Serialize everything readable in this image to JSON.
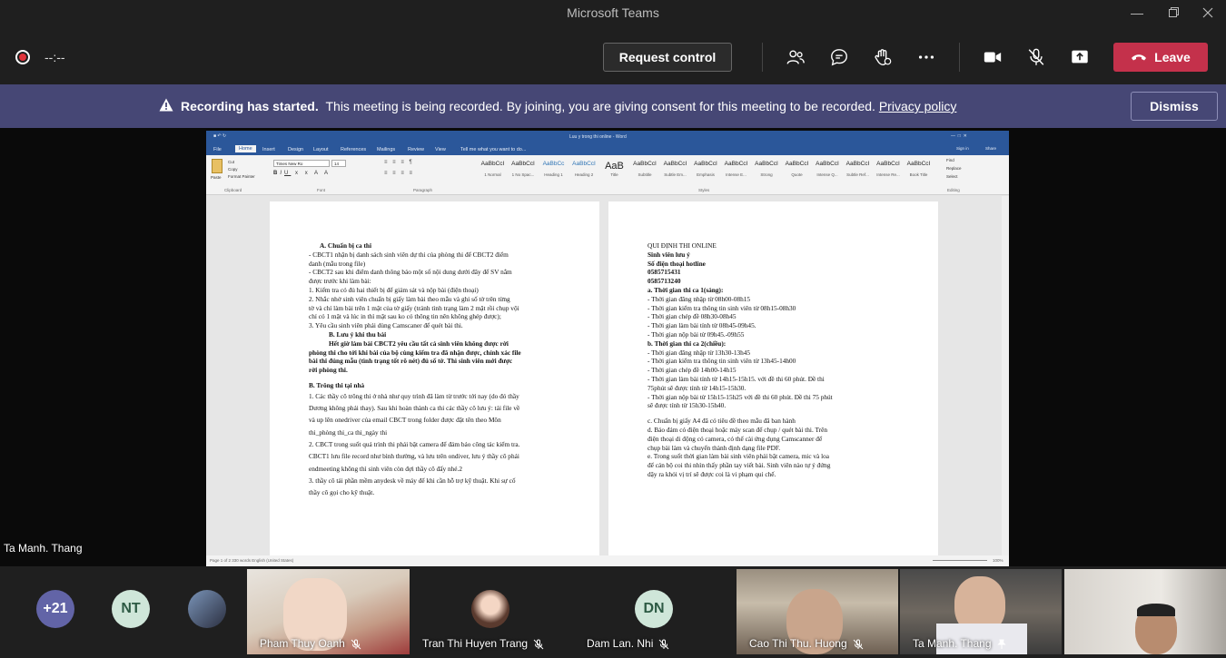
{
  "app_title": "Microsoft Teams",
  "toolbar": {
    "timer": "--:--",
    "request_control": "Request control",
    "leave": "Leave"
  },
  "banner": {
    "bold": "Recording has started.",
    "text": "This meeting is being recorded. By joining, you are giving consent for this meeting to be recorded.",
    "link": "Privacy policy",
    "dismiss": "Dismiss"
  },
  "word": {
    "title": "Luu y trong thi online - Word",
    "tabs": [
      "File",
      "Home",
      "Insert",
      "Design",
      "Layout",
      "References",
      "Mailings",
      "Review",
      "View",
      "Tell me what you want to do..."
    ],
    "sign_in": "Sign in",
    "share": "Share",
    "groups": [
      "Clipboard",
      "Font",
      "Paragraph",
      "Styles",
      "Editing"
    ],
    "clipboard": [
      "Paste",
      "Cut",
      "Copy",
      "Format Painter"
    ],
    "font_name": "Times New Ro",
    "font_size": "14",
    "styles": [
      {
        "sample": "AaBbCcI",
        "name": "1 Normal"
      },
      {
        "sample": "AaBbCcI",
        "name": "1 No Spac..."
      },
      {
        "sample": "AaBbCc",
        "name": "Heading 1"
      },
      {
        "sample": "AaBbCcI",
        "name": "Heading 2"
      },
      {
        "sample": "AaB",
        "name": "Title"
      },
      {
        "sample": "AaBbCcI",
        "name": "Subtitle"
      },
      {
        "sample": "AaBbCcI",
        "name": "Subtle Em..."
      },
      {
        "sample": "AaBbCcI",
        "name": "Emphasis"
      },
      {
        "sample": "AaBbCcI",
        "name": "Intense E..."
      },
      {
        "sample": "AaBbCcI",
        "name": "Strong"
      },
      {
        "sample": "AaBbCcI",
        "name": "Quote"
      },
      {
        "sample": "AaBbCcI",
        "name": "Intense Q..."
      },
      {
        "sample": "AaBbCcI",
        "name": "Subtle Ref..."
      },
      {
        "sample": "AaBbCcI",
        "name": "Intense Re..."
      },
      {
        "sample": "AaBbCcI",
        "name": "Book Title"
      }
    ],
    "editing": [
      "Find",
      "Replace",
      "Select"
    ],
    "status_left": "Page 1 of 2    330 words    English (United States)",
    "zoom": "100%",
    "page1": [
      {
        "t": "A. Chuẩn bị ca thi",
        "b": true,
        "indent": 12
      },
      {
        "t": "- CBCT1 nhận bị danh sách sinh viên dự thi của phòng thi để CBCT2 điểm",
        "b": false
      },
      {
        "t": "danh (mẫu trong file)",
        "b": false
      },
      {
        "t": "- CBCT2 sau khi điểm danh thông báo một số nội dung dưới đây để SV nắm",
        "b": false
      },
      {
        "t": "được trước khi làm bài:",
        "b": false
      },
      {
        "t": "1. Kiểm tra có đủ hai thiết bị để giám sát và nộp bài (điện thoại)",
        "b": false
      },
      {
        "t": "2. Nhắc nhở sinh viên chuẩn bị giấy làm bài theo mẫu và ghi số tờ trên từng",
        "b": false
      },
      {
        "t": "tờ và chỉ làm bài trên 1 mặt của tờ giấy (tránh tình trạng làm 2 mặt rồi chụp vội",
        "b": false
      },
      {
        "t": "chỉ có 1 mặt và lúc in thì mặt sau ko có thông tin nên không ghép được);",
        "b": false
      },
      {
        "t": "3. Yêu cầu sinh viên phải dùng Camscaner để quét bài thi.",
        "b": false
      },
      {
        "t": "B. Lưu ý khi thu bài",
        "b": true,
        "indent": 22
      },
      {
        "t": "Hết giờ làm bài CBCT2 yêu cầu tất cả sinh viên không được rời",
        "b": true,
        "indent": 22
      },
      {
        "t": "phòng thi cho tới khi bài của bộ cùng kiểm tra đã nhận được, chính xác file",
        "b": true
      },
      {
        "t": "bài thi đúng mẫu (tình trạng tốt rõ nét) đủ số tờ. Thì sinh viên mới được",
        "b": true
      },
      {
        "t": "rời phòng thi.",
        "b": true
      },
      {
        "t": "",
        "b": false
      },
      {
        "t": "B. Trông thi tại nhà",
        "b": true
      },
      {
        "t": "1. Các thầy cô trông thi ở nhà như quy trình đã làm từ trước tới nay (do đó thầy",
        "b": false
      },
      {
        "t": "Dương không phải thay). Sau khi hoàn thành ca thi các thầy cô lưu ý: tải file về",
        "b": false
      },
      {
        "t": "và up lên onedriver của email CBCT trong folder được đặt tên theo Môn",
        "b": false
      },
      {
        "t": "thi_phòng thi_ca thi_ngày thi",
        "b": false
      },
      {
        "t": "2. CBCT trong suốt quá trình thi phải bật camera để đảm bảo công tác kiểm tra.",
        "b": false
      },
      {
        "t": "CBCT1 lưu file record như bình thường, và lưu trên ondiver, lưu ý thầy cô phải",
        "b": false
      },
      {
        "t": "endmeeting không thì sinh viên còn đợi thầy cô đấy nhé.2",
        "b": false
      },
      {
        "t": "3. thầy cô tải phần mềm anydesk về máy để khi cần hỗ trợ kỹ thuật. Khi sự cố",
        "b": false
      },
      {
        "t": "thầy cô gọi cho kỹ thuật.",
        "b": false
      }
    ],
    "page2": [
      {
        "t": "QUI ĐỊNH THI ONLINE",
        "b": false
      },
      {
        "t": "Sinh viên lưu ý",
        "b": true
      },
      {
        "t": "Số điện thoại hotline",
        "b": true
      },
      {
        "t": " 0585715431",
        "b": true
      },
      {
        "t": " 0585713240",
        "b": true
      },
      {
        "t": "a. Thời gian thi ca 1(sáng):",
        "b": true
      },
      {
        "t": "- Thời gian đăng nhập từ 08h00-08h15",
        "b": false
      },
      {
        "t": "- Thời gian kiểm tra thông tin sinh viên từ 08h15-08h30",
        "b": false
      },
      {
        "t": "- Thời gian chép đề 08h30-08h45",
        "b": false
      },
      {
        "t": "- Thời gian làm bài tính từ 08h45-09h45.",
        "b": false
      },
      {
        "t": "- Thời gian nộp bài từ 09h45.-09h55",
        "b": false
      },
      {
        "t": "b. Thời gian thi ca 2(chiều):",
        "b": true
      },
      {
        "t": "- Thời gian đăng nhập từ 13h30-13h45",
        "b": false
      },
      {
        "t": "- Thời gian kiểm tra thông tin sinh viên từ 13h45-14h00",
        "b": false
      },
      {
        "t": "- Thời gian chép đề 14h00-14h15",
        "b": false
      },
      {
        "t": "- Thời gian làm bài tính từ 14h15-15h15. với đề thi 60 phút. Đề thi",
        "b": false
      },
      {
        "t": "75phút sẽ được tính từ 14h15-15h30.",
        "b": false
      },
      {
        "t": "- Thời gian nộp bài từ 15h15-15h25 với đề thi 60 phút. Đề thi 75 phút",
        "b": false
      },
      {
        "t": "sẽ được tính từ 15h30-15h40.",
        "b": false
      },
      {
        "t": "",
        "b": false
      },
      {
        "t": "c. Chuẩn bị giấy A4 đã có tiêu đề theo mẫu đã ban hành",
        "b": false
      },
      {
        "t": "d. Bảo đảm có điện thoại hoặc máy scan để chụp / quét bài thi. Trên",
        "b": false
      },
      {
        "t": "điện thoại di động có camera, có thể cài ứng dụng Camscanner để",
        "b": false
      },
      {
        "t": "chụp bài làm và chuyển thành định dạng file PDF.",
        "b": false
      },
      {
        "t": "e. Trong suốt thời gian làm bài sinh viên phải bật camera, mic và loa",
        "b": false
      },
      {
        "t": "để cán bộ coi thi nhìn thấy phần tay viết bài. Sinh viên nào tự ý đứng",
        "b": false
      },
      {
        "t": "dậy ra khỏi vị trí sẽ được coi là vi phạm qui chế.",
        "b": false
      }
    ]
  },
  "speaker": "Ta Manh. Thang",
  "participants": {
    "more_count": "+21",
    "nt_initials": "NT",
    "dn_initials": "DN",
    "tiles": [
      {
        "name": "Pham Thuy Oanh",
        "muted": true
      },
      {
        "name": "Tran Thi Huyen Trang",
        "muted": true
      },
      {
        "name": "Dam Lan. Nhi",
        "muted": true
      },
      {
        "name": "Cao Thi Thu. Huong",
        "muted": true
      },
      {
        "name": "Ta Manh. Thang",
        "pinned": true
      }
    ]
  },
  "colors": {
    "leave_red": "#c4314b",
    "banner_purple": "#464775",
    "word_blue": "#2b579a"
  }
}
